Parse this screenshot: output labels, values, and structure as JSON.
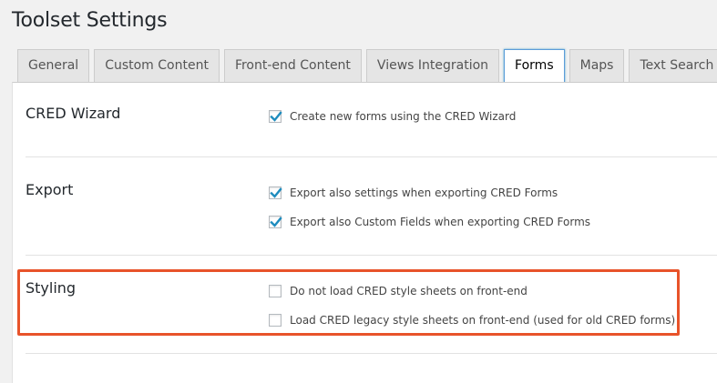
{
  "page": {
    "title": "Toolset Settings"
  },
  "tabs": [
    {
      "label": "General",
      "active": false
    },
    {
      "label": "Custom Content",
      "active": false
    },
    {
      "label": "Front-end Content",
      "active": false
    },
    {
      "label": "Views Integration",
      "active": false
    },
    {
      "label": "Forms",
      "active": true
    },
    {
      "label": "Maps",
      "active": false
    },
    {
      "label": "Text Search",
      "active": false
    }
  ],
  "sections": {
    "wizard": {
      "title": "CRED Wizard",
      "options": [
        {
          "label": "Create new forms using the CRED Wizard",
          "checked": true
        }
      ]
    },
    "export": {
      "title": "Export",
      "options": [
        {
          "label": "Export also settings when exporting CRED Forms",
          "checked": true
        },
        {
          "label": "Export also Custom Fields when exporting CRED Forms",
          "checked": true
        }
      ]
    },
    "styling": {
      "title": "Styling",
      "options": [
        {
          "label": "Do not load CRED style sheets on front-end",
          "checked": false
        },
        {
          "label": "Load CRED legacy style sheets on front-end (used for old CRED forms)",
          "checked": false
        }
      ]
    }
  },
  "colors": {
    "highlight": "#e8532a",
    "checkmark": "#1e8cbe",
    "active_tab_border": "#5b9dd9"
  }
}
